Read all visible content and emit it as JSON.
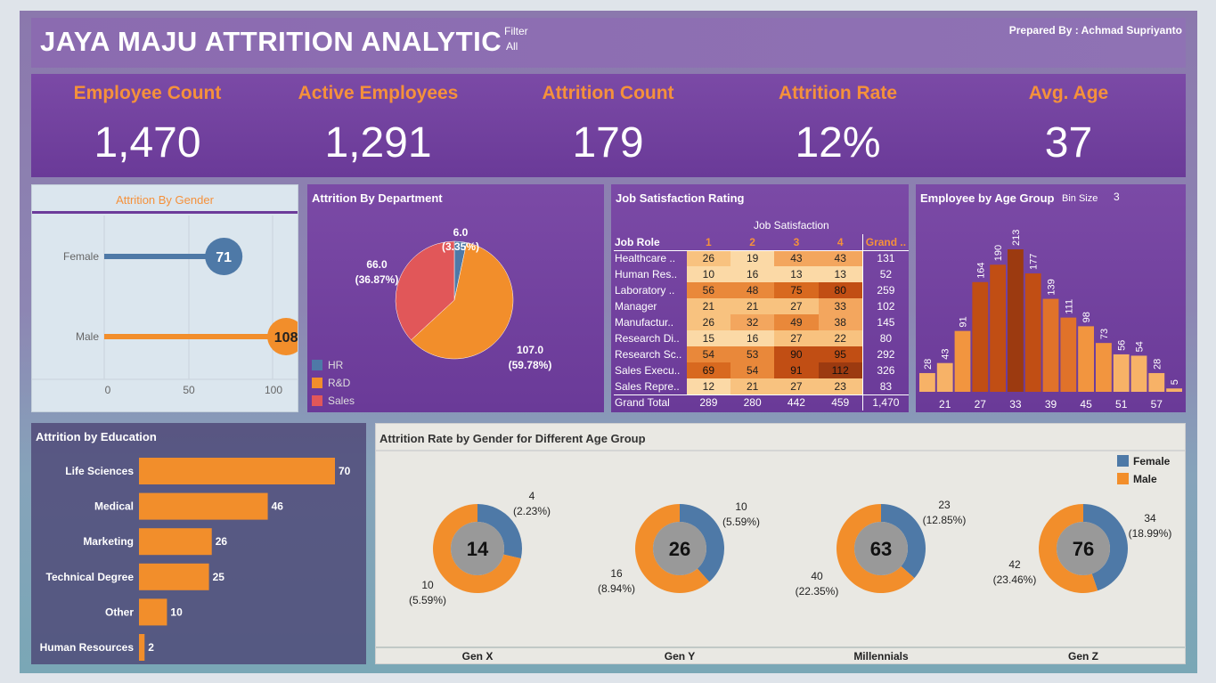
{
  "header": {
    "title": "JAYA MAJU ATTRITION ANALYTIC",
    "filter_label": "Filter",
    "filter_value": "All",
    "prepared_by": "Prepared By : Achmad Supriyanto"
  },
  "kpis": [
    {
      "label": "Employee Count",
      "value": "1,470"
    },
    {
      "label": "Active Employees",
      "value": "1,291"
    },
    {
      "label": "Attrition Count",
      "value": "179"
    },
    {
      "label": "Attrition Rate",
      "value": "12%"
    },
    {
      "label": "Avg. Age",
      "value": "37"
    }
  ],
  "colors": {
    "accent": "#f5913b",
    "male": "#f28e2b",
    "female": "#4e79a7",
    "sales": "#e15759",
    "panel": "#6c3b9a"
  },
  "gender_panel": {
    "title": "Attrition By Gender",
    "rows": [
      {
        "label": "Female",
        "value": 71
      },
      {
        "label": "Male",
        "value": 108
      }
    ],
    "ticks": [
      "0",
      "50",
      "100"
    ]
  },
  "dept_panel": {
    "title": "Attrition By Department",
    "legend": [
      "HR",
      "R&D",
      "Sales"
    ],
    "slices": [
      {
        "name": "HR",
        "value": 6.0,
        "label": "6.0",
        "pct": "(3.35%)"
      },
      {
        "name": "R&D",
        "value": 107.0,
        "label": "107.0",
        "pct": "(59.78%)"
      },
      {
        "name": "Sales",
        "value": 66.0,
        "label": "66.0",
        "pct": "(36.87%)"
      }
    ]
  },
  "job_panel": {
    "title": "Job Satisfaction Rating",
    "col_group": "Job Satisfaction",
    "row_header": "Job Role",
    "cols": [
      "1",
      "2",
      "3",
      "4",
      "Grand .."
    ],
    "rows": [
      {
        "role": "Healthcare ..",
        "v": [
          26,
          19,
          43,
          43
        ],
        "total": "131"
      },
      {
        "role": "Human Res..",
        "v": [
          10,
          16,
          13,
          13
        ],
        "total": "52"
      },
      {
        "role": "Laboratory ..",
        "v": [
          56,
          48,
          75,
          80
        ],
        "total": "259"
      },
      {
        "role": "Manager",
        "v": [
          21,
          21,
          27,
          33
        ],
        "total": "102"
      },
      {
        "role": "Manufactur..",
        "v": [
          26,
          32,
          49,
          38
        ],
        "total": "145"
      },
      {
        "role": "Research Di..",
        "v": [
          15,
          16,
          27,
          22
        ],
        "total": "80"
      },
      {
        "role": "Research Sc..",
        "v": [
          54,
          53,
          90,
          95
        ],
        "total": "292"
      },
      {
        "role": "Sales Execu..",
        "v": [
          69,
          54,
          91,
          112
        ],
        "total": "326"
      },
      {
        "role": "Sales Repre..",
        "v": [
          12,
          21,
          27,
          23
        ],
        "total": "83"
      }
    ],
    "grand": {
      "label": "Grand Total",
      "v": [
        "289",
        "280",
        "442",
        "459"
      ],
      "total": "1,470"
    }
  },
  "age_panel": {
    "title": "Employee by Age Group",
    "bin_label": "Bin Size",
    "bin_value": "3",
    "values": [
      28,
      43,
      91,
      164,
      190,
      213,
      177,
      139,
      111,
      98,
      73,
      56,
      54,
      28,
      5
    ],
    "ticks": [
      "21",
      "27",
      "33",
      "39",
      "45",
      "51",
      "57"
    ]
  },
  "edu_panel": {
    "title": "Attrition by Education",
    "categories": [
      "Life Sciences",
      "Medical",
      "Marketing",
      "Technical Degree",
      "Other",
      "Human Resources"
    ],
    "values": [
      70,
      46,
      26,
      25,
      10,
      2
    ]
  },
  "agegender_panel": {
    "title": "Attrition Rate by Gender for Different Age Group",
    "legend": [
      "Female",
      "Male"
    ],
    "groups": [
      {
        "name": "Gen X",
        "total": "14",
        "female": 4,
        "male": 10,
        "f_label": "4",
        "f_pct": "(2.23%)",
        "m_label": "10",
        "m_pct": "(5.59%)"
      },
      {
        "name": "Gen Y",
        "total": "26",
        "female": 10,
        "male": 16,
        "f_label": "10",
        "f_pct": "(5.59%)",
        "m_label": "16",
        "m_pct": "(8.94%)"
      },
      {
        "name": "Millennials",
        "total": "63",
        "female": 23,
        "male": 40,
        "f_label": "23",
        "f_pct": "(12.85%)",
        "m_label": "40",
        "m_pct": "(22.35%)"
      },
      {
        "name": "Gen Z",
        "total": "76",
        "female": 34,
        "male": 42,
        "f_label": "34",
        "f_pct": "(18.99%)",
        "m_label": "42",
        "m_pct": "(23.46%)"
      }
    ]
  },
  "chart_data": [
    {
      "type": "bar",
      "title": "Attrition By Gender",
      "categories": [
        "Female",
        "Male"
      ],
      "values": [
        71,
        108
      ],
      "xlim": [
        0,
        110
      ]
    },
    {
      "type": "pie",
      "title": "Attrition By Department",
      "categories": [
        "HR",
        "R&D",
        "Sales"
      ],
      "values": [
        6,
        107,
        66
      ]
    },
    {
      "type": "heatmap",
      "title": "Job Satisfaction Rating",
      "x": [
        "1",
        "2",
        "3",
        "4"
      ],
      "y": [
        "Healthcare ..",
        "Human Res..",
        "Laboratory ..",
        "Manager",
        "Manufactur..",
        "Research Di..",
        "Research Sc..",
        "Sales Execu..",
        "Sales Repre.."
      ]
    },
    {
      "type": "bar",
      "title": "Employee by Age Group",
      "values": [
        28,
        43,
        91,
        164,
        190,
        213,
        177,
        139,
        111,
        98,
        73,
        56,
        54,
        28,
        5
      ]
    },
    {
      "type": "bar",
      "title": "Attrition by Education",
      "categories": [
        "Life Sciences",
        "Medical",
        "Marketing",
        "Technical Degree",
        "Other",
        "Human Resources"
      ],
      "values": [
        70,
        46,
        26,
        25,
        10,
        2
      ]
    },
    {
      "type": "pie",
      "title": "Attrition Rate by Gender for Different Age Group",
      "categories": [
        "Gen X",
        "Gen Y",
        "Millennials",
        "Gen Z"
      ],
      "series": [
        {
          "name": "Female",
          "values": [
            4,
            10,
            23,
            34
          ]
        },
        {
          "name": "Male",
          "values": [
            10,
            16,
            40,
            42
          ]
        }
      ]
    }
  ]
}
